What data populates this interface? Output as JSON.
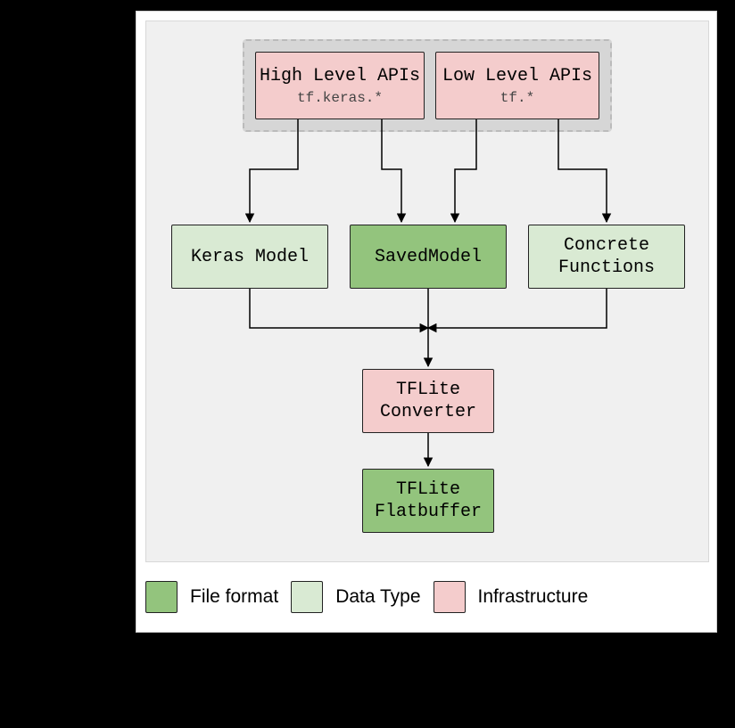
{
  "nodes": {
    "high_api": {
      "title": "High Level APIs",
      "sub": "tf.keras.*"
    },
    "low_api": {
      "title": "Low Level APIs",
      "sub": "tf.*"
    },
    "keras_model": {
      "title": "Keras Model"
    },
    "saved_model": {
      "title": "SavedModel"
    },
    "concrete_fns": {
      "title": "Concrete\nFunctions"
    },
    "converter": {
      "title": "TFLite\nConverter"
    },
    "flatbuffer": {
      "title": "TFLite\nFlatbuffer"
    }
  },
  "legend": {
    "file_format": "File format",
    "data_type": "Data Type",
    "infrastructure": "Infrastructure"
  },
  "colors": {
    "pink": "#f4cccc",
    "lightgreen": "#d9ead3",
    "green": "#93c47d"
  }
}
